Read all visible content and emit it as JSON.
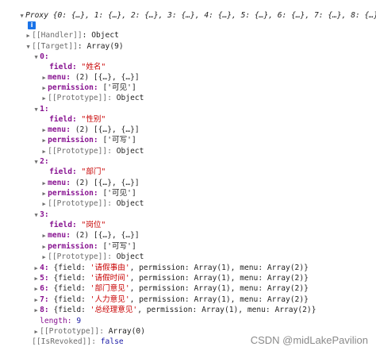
{
  "proxy_summary": "Proxy {0: {…}, 1: {…}, 2: {…}, 3: {…}, 4: {…}, 5: {…}, 6: {…}, 7: {…}, 8: {…}}",
  "info_glyph": "i",
  "handler": {
    "key": "[[Handler]]",
    "value": "Object"
  },
  "target": {
    "key": "[[Target]]",
    "value": "Array(9)"
  },
  "items": [
    {
      "index": "0:",
      "field": "\"姓名\"",
      "menu": "(2) [{…}, {…}]",
      "permission": "['可见']"
    },
    {
      "index": "1:",
      "field": "\"性别\"",
      "menu": "(2) [{…}, {…}]",
      "permission": "['可写']"
    },
    {
      "index": "2:",
      "field": "\"部门\"",
      "menu": "(2) [{…}, {…}]",
      "permission": "['可见']"
    },
    {
      "index": "3:",
      "field": "\"岗位\"",
      "menu": "(2) [{…}, {…}]",
      "permission": "['可写']"
    }
  ],
  "labels": {
    "field": "field:",
    "menu": "menu:",
    "permission": "permission:",
    "prototype_key": "[[Prototype]]:",
    "prototype_value": "Object"
  },
  "collapsed": [
    {
      "index": "4:",
      "open": "{field: ",
      "field": "'请假事由'",
      "rest": ", permission: Array(1), menu: Array(2)}"
    },
    {
      "index": "5:",
      "open": "{field: ",
      "field": "'请假时间'",
      "rest": ", permission: Array(1), menu: Array(2)}"
    },
    {
      "index": "6:",
      "open": "{field: ",
      "field": "'部门意见'",
      "rest": ", permission: Array(1), menu: Array(2)}"
    },
    {
      "index": "7:",
      "open": "{field: ",
      "field": "'人力意见'",
      "rest": ", permission: Array(1), menu: Array(2)}"
    },
    {
      "index": "8:",
      "open": "{field: ",
      "field": "'总经理意见'",
      "rest": ", permission: Array(1), menu: Array(2)}"
    }
  ],
  "length": {
    "key": "length:",
    "value": "9"
  },
  "array_prototype": {
    "key": "[[Prototype]]:",
    "value": "Array(0)"
  },
  "revoked": {
    "key": "[[IsRevoked]]:",
    "value": "false"
  },
  "watermark": "CSDN @midLakePavilion"
}
